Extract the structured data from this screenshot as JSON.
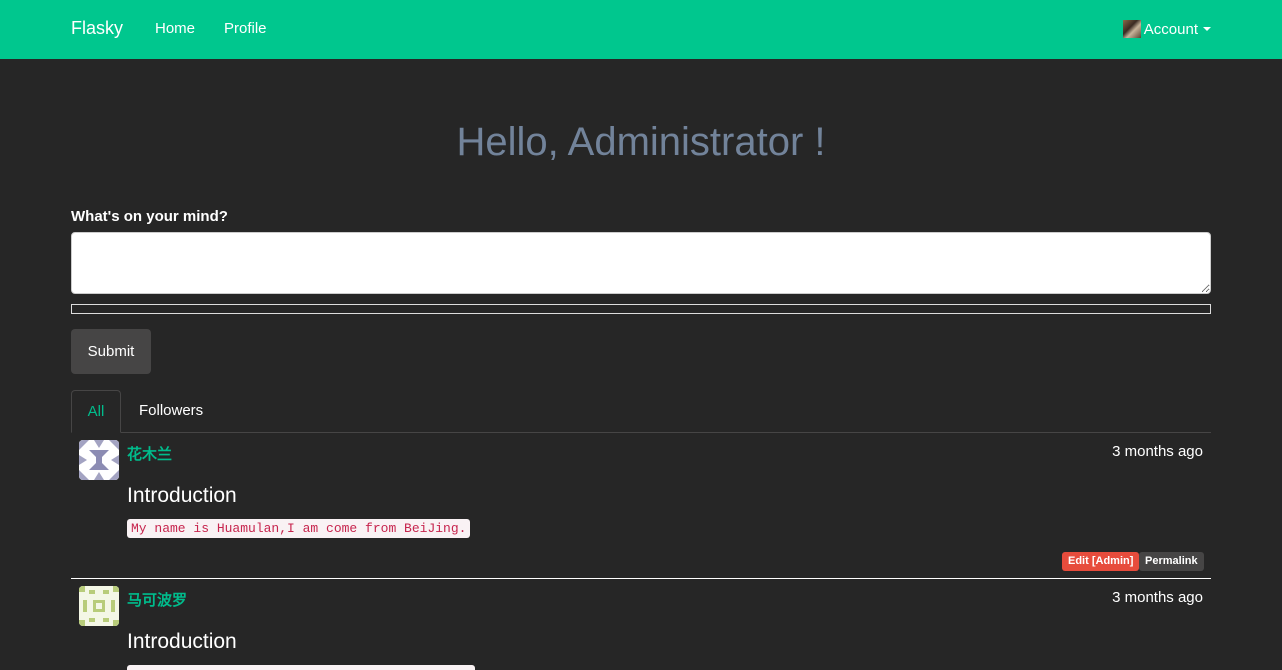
{
  "navbar": {
    "brand": "Flasky",
    "links": [
      "Home",
      "Profile"
    ],
    "account_label": "Account"
  },
  "greeting": "Hello, Administrator !",
  "form": {
    "label": "What's on your mind?",
    "textarea_value": "",
    "submit_label": "Submit"
  },
  "tabs": [
    "All",
    "Followers"
  ],
  "posts": [
    {
      "author": "花木兰",
      "date": "3 months ago",
      "title": "Introduction",
      "code": "My name is Huamulan,I am come from BeiJing.",
      "edit_label": "Edit [Admin]",
      "permalink_label": "Permalink"
    },
    {
      "author": "马可波罗",
      "date": "3 months ago",
      "title": "Introduction"
    }
  ],
  "colors": {
    "navbar": "#00c78e",
    "background": "#262626",
    "greeting": "#72839a",
    "accent": "#00bc8c",
    "danger": "#e74c3c",
    "code_text": "#c7254e"
  }
}
